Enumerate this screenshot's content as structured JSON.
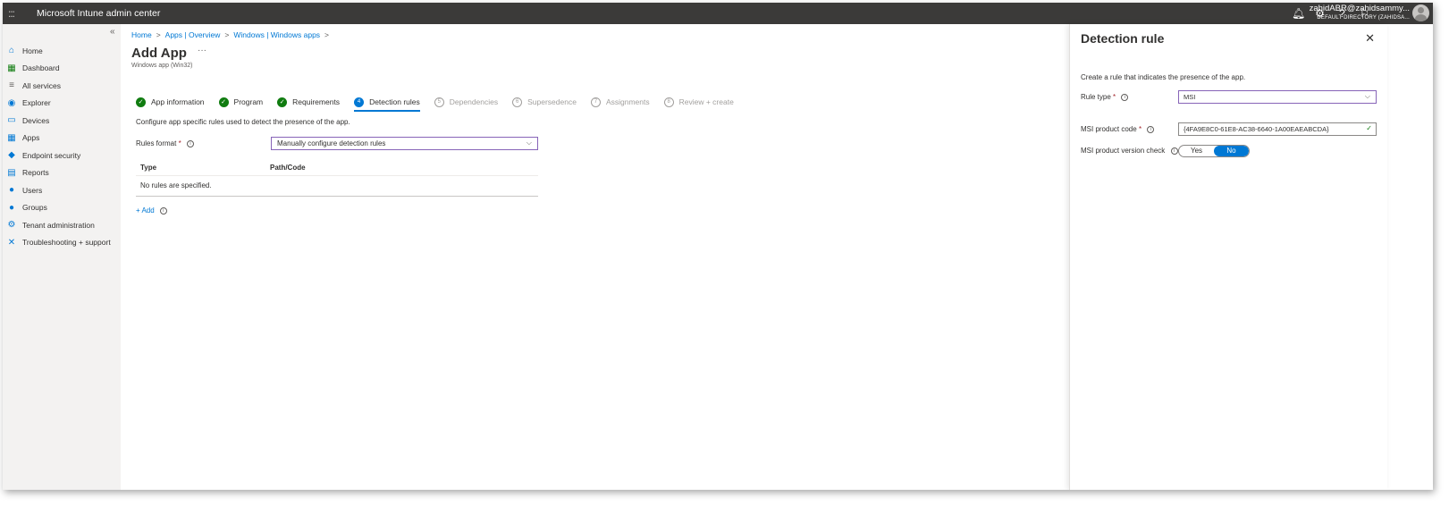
{
  "topbar": {
    "waffle": ":::",
    "title": "Microsoft Intune admin center",
    "icons": [
      "bell-icon",
      "gear-icon",
      "help-icon",
      "feedback-icon"
    ],
    "user": "zahidABR@zahidsammy...",
    "directory": "DEFAULT DIRECTORY (ZAHIDSA..."
  },
  "sidebar": {
    "collapse": "«",
    "items": [
      {
        "label": "Home",
        "icon": "home-icon",
        "glyph": "⌂",
        "color": "#0078d4"
      },
      {
        "label": "Dashboard",
        "icon": "dashboard-icon",
        "glyph": "▦",
        "color": "#107c10"
      },
      {
        "label": "All services",
        "icon": "list-icon",
        "glyph": "≡",
        "color": "#605e5c"
      },
      {
        "label": "Explorer",
        "icon": "explorer-icon",
        "glyph": "◉",
        "color": "#0078d4"
      },
      {
        "label": "Devices",
        "icon": "devices-icon",
        "glyph": "▭",
        "color": "#0078d4"
      },
      {
        "label": "Apps",
        "icon": "apps-icon",
        "glyph": "▦",
        "color": "#0078d4"
      },
      {
        "label": "Endpoint security",
        "icon": "shield-icon",
        "glyph": "◆",
        "color": "#0078d4"
      },
      {
        "label": "Reports",
        "icon": "reports-icon",
        "glyph": "▤",
        "color": "#0078d4"
      },
      {
        "label": "Users",
        "icon": "user-icon",
        "glyph": "●",
        "color": "#0078d4"
      },
      {
        "label": "Groups",
        "icon": "groups-icon",
        "glyph": "●",
        "color": "#0078d4"
      },
      {
        "label": "Tenant administration",
        "icon": "tenant-icon",
        "glyph": "⚙",
        "color": "#0078d4"
      },
      {
        "label": "Troubleshooting + support",
        "icon": "wrench-icon",
        "glyph": "✕",
        "color": "#0078d4"
      }
    ]
  },
  "main": {
    "breadcrumb": [
      "Home",
      "Apps | Overview",
      "Windows | Windows apps"
    ],
    "title": "Add App",
    "more": "···",
    "subtitle": "Windows app (Win32)",
    "steps": [
      {
        "label": "App information",
        "state": "done",
        "mark": "✓"
      },
      {
        "label": "Program",
        "state": "done",
        "mark": "✓"
      },
      {
        "label": "Requirements",
        "state": "done",
        "mark": "✓"
      },
      {
        "label": "Detection rules",
        "state": "active",
        "mark": "4"
      },
      {
        "label": "Dependencies",
        "state": "todo",
        "mark": "5"
      },
      {
        "label": "Supersedence",
        "state": "todo",
        "mark": "6"
      },
      {
        "label": "Assignments",
        "state": "todo",
        "mark": "7"
      },
      {
        "label": "Review + create",
        "state": "todo",
        "mark": "8"
      }
    ],
    "description": "Configure app specific rules used to detect the presence of the app.",
    "rules_format_label": "Rules format",
    "rules_format_value": "Manually configure detection rules",
    "table": {
      "columns": [
        "Type",
        "Path/Code"
      ],
      "empty": "No rules are specified."
    },
    "add_label": "+ Add"
  },
  "panel": {
    "title": "Detection rule",
    "close": "✕",
    "description": "Create a rule that indicates the presence of the app.",
    "rule_type_label": "Rule type",
    "rule_type_value": "MSI",
    "product_code_label": "MSI product code",
    "product_code_value": "{4FA9E8C0-61E8-AC38-6640-1A00EAEABCDA}",
    "version_check_label": "MSI product version check",
    "toggle": {
      "yes": "Yes",
      "no": "No",
      "selected": "No"
    }
  },
  "common": {
    "required_mark": "*",
    "info_mark": "i",
    "chevron": "⌵",
    "check": "✓",
    "bc_sep": ">"
  }
}
